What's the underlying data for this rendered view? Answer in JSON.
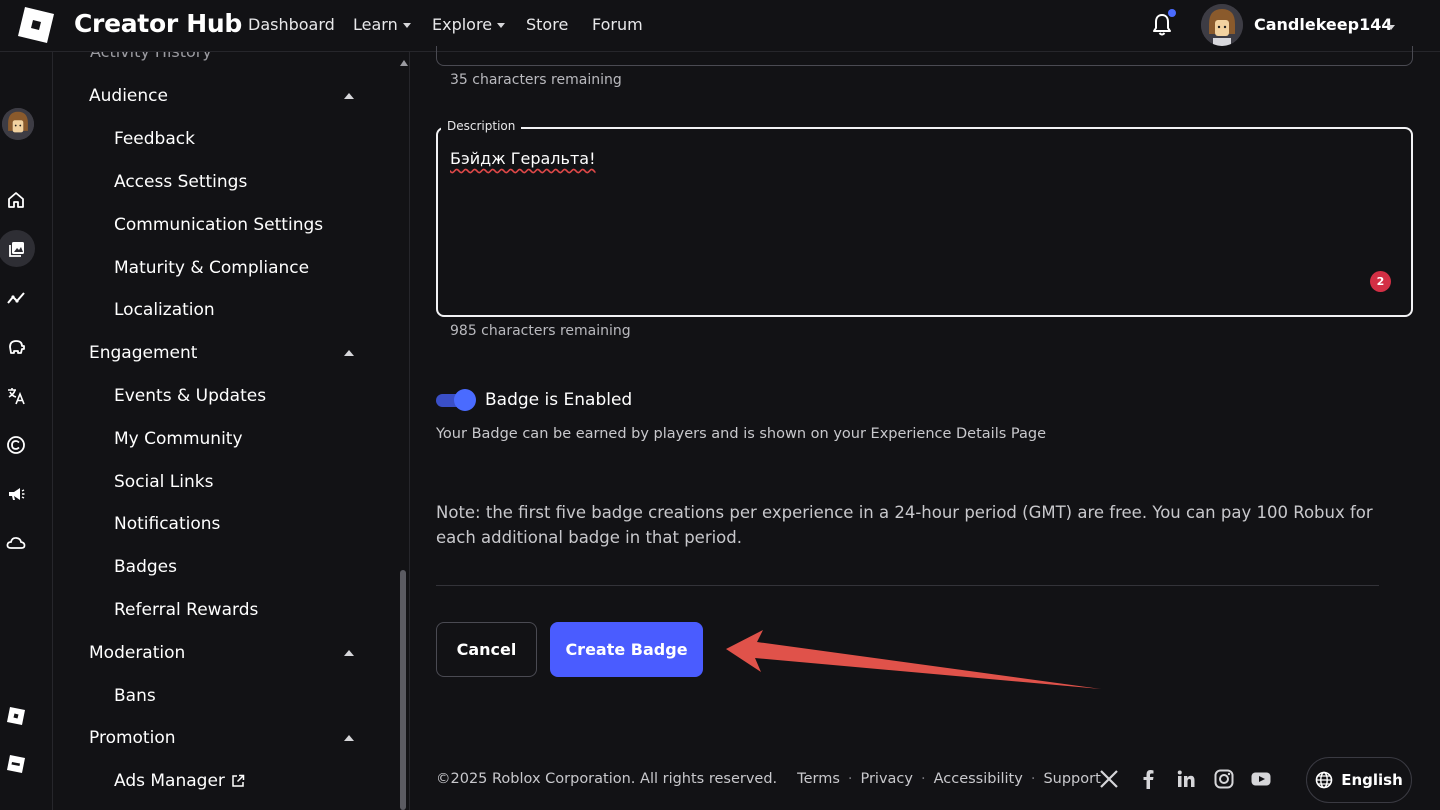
{
  "brand": "Creator Hub",
  "nav": [
    {
      "label": "Dashboard",
      "has_caret": false
    },
    {
      "label": "Learn",
      "has_caret": true
    },
    {
      "label": "Explore",
      "has_caret": true
    },
    {
      "label": "Store",
      "has_caret": false
    },
    {
      "label": "Forum",
      "has_caret": false
    }
  ],
  "user": {
    "name": "Candlekeep144"
  },
  "sidebar": {
    "cut_off_item": "Activity History",
    "groups": [
      {
        "label": "Audience",
        "items": [
          "Feedback",
          "Access Settings",
          "Communication Settings",
          "Maturity & Compliance",
          "Localization"
        ]
      },
      {
        "label": "Engagement",
        "items": [
          "Events & Updates",
          "My Community",
          "Social Links",
          "Notifications",
          "Badges",
          "Referral Rewards"
        ]
      },
      {
        "label": "Moderation",
        "items": [
          "Bans"
        ]
      },
      {
        "label": "Promotion",
        "items": [
          "Ads Manager"
        ]
      }
    ]
  },
  "rail_icons": [
    "home-icon",
    "creations-icon",
    "analytics-icon",
    "monetization-icon",
    "translate-icon",
    "copyright-icon",
    "ads-megaphone-icon",
    "cloud-icon",
    "roblox-logo-icon",
    "roblox-wordmark-icon"
  ],
  "form": {
    "name_remaining": "35 characters remaining",
    "description_label": "Description",
    "description_value": "Бэйдж Геральта!",
    "description_issue_count": "2",
    "description_remaining": "985 characters remaining",
    "toggle_label": "Badge is Enabled",
    "toggle_on": true,
    "toggle_help": "Your Badge can be earned by players and is shown on your Experience Details Page",
    "note": "Note: the first five badge creations per experience in a 24-hour period (GMT) are free. You can pay 100 Robux for each additional badge in that period.",
    "cancel_label": "Cancel",
    "create_label": "Create Badge"
  },
  "footer": {
    "copyright": "©2025 Roblox Corporation. All rights reserved.",
    "links": [
      "Terms",
      "Privacy",
      "Accessibility",
      "Support"
    ],
    "social_icons": [
      "x-icon",
      "facebook-icon",
      "linkedin-icon",
      "instagram-icon",
      "youtube-icon"
    ],
    "language": "English"
  },
  "colors": {
    "background": "#121215",
    "accent": "#4a5cff",
    "error": "#d32f45",
    "annotation_arrow": "#e0524a"
  }
}
